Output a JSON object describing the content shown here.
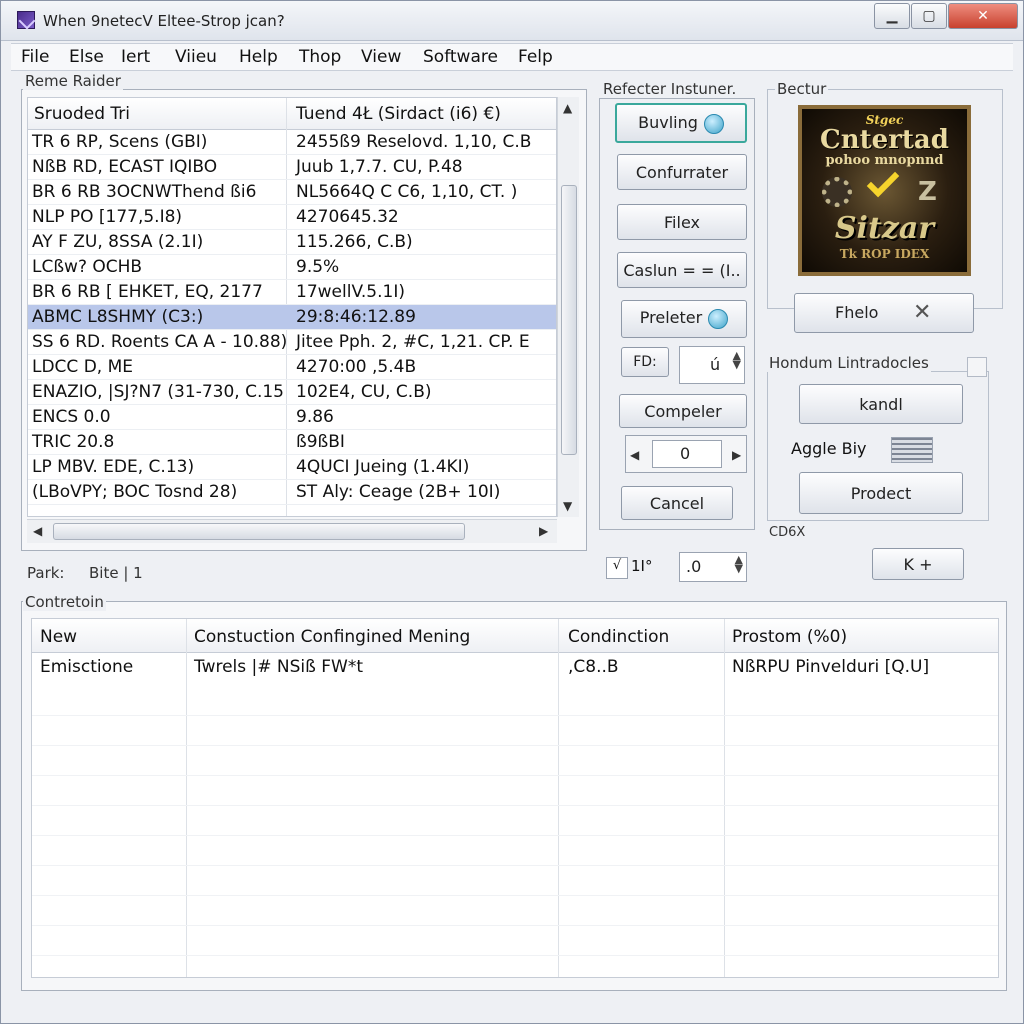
{
  "window": {
    "title": "When 9netecV Eltee-Strop jcan?",
    "controls": [
      "▁",
      "▢",
      "✕"
    ]
  },
  "menu": [
    "File",
    "Else",
    "Iert",
    "Viieu",
    "Help",
    "Thop",
    "View",
    "Software",
    "Felp"
  ],
  "left_panel": {
    "group_label": "Reme Raider",
    "columns": [
      "Sruoded Tri",
      "Tuend 4Ł (Sirdact (i6) €)"
    ],
    "rows": [
      [
        "TR 6 RP, Scens (GBI)",
        "2455ß9 Reselovd. 1,10, C.B"
      ],
      [
        "NßB RD, ECAST IQIBO",
        "Juub 1,7.7. CU, P.48"
      ],
      [
        "BR 6 RB 3OCNWThend ßi6",
        "NL5664Q C C6, 1,10, CT. )"
      ],
      [
        "NLP PO [177,5.I8)",
        "4270645.32"
      ],
      [
        "AY F ZU, 8SSA (2.1I)",
        "115.266, C.B)"
      ],
      [
        "LCßw? OCHB",
        "9.5%"
      ],
      [
        "BR 6 RB [ EHKET, EQ, 2177",
        "17wellV.5.1I)"
      ],
      [
        "ABMC L8SHMY (C3:)",
        "29:8:46:12.89"
      ],
      [
        "SS 6 RD. Roents CA A - 10.88)",
        "Jitee Pph. 2, #C, 1,21. CP. E"
      ],
      [
        "LDCC D, ME",
        "4270:00 ,5.4B"
      ],
      [
        "ENAZIO, |SJ?N7 (31-730, C.15",
        "102E4, CU, C.B)"
      ],
      [
        "ENCS 0.0",
        "9.86"
      ],
      [
        "TRIC 20.8",
        "ß9ßBI"
      ],
      [
        "LP MBV. EDE, C.13)",
        "4QUCI Jueing (1.4KI)"
      ],
      [
        "(LBoVPY; BOC Tosnd 28)",
        "ST Aly: Ceage (2B+ 10I)"
      ]
    ],
    "selected_row": 7,
    "status_label": "Park:",
    "status_value": "Bite | 1"
  },
  "middle_panel": {
    "group_label": "Refecter Instuner.",
    "buttons": {
      "b1": "Buvling",
      "b2": "Confurrater",
      "b3": "Filex",
      "b4": "Caslun = = (I..",
      "b5": "Preleter",
      "b6": "FD:",
      "b7": "Compeler",
      "b8": "Cancel"
    },
    "field1_value": "ú",
    "field2_value": "0",
    "field3_prefix": "√",
    "bottom_spin_label": "1I°",
    "bottom_spin_value": ".0"
  },
  "right_panel": {
    "group_label": "Bectur",
    "logo_text": {
      "line1": "Stgec",
      "line2": "Cntertad",
      "line3": "pohoo mnopnnd",
      "line4": "Sitzar",
      "line5": "Tk  ROP IDEX"
    },
    "logo_glyph": "Z",
    "fhelo_label": "Fhelo",
    "group2_label": "Hondum Lintradocles",
    "buttons": {
      "kandl": "kandl",
      "agglebly_label": "Aggle Biy",
      "prodect": "Prodect",
      "k_plus": "K +"
    },
    "cdex_label": "CD6X"
  },
  "bottom_panel": {
    "group_label": "Contretoin",
    "columns": [
      "New",
      "Constuction Confingined Mening",
      "Condinction",
      "Prostom (%0)"
    ],
    "rows": [
      [
        "Emisctione",
        "Twrels |# NSiß FW*t",
        ",C8..B",
        "NßRPU Pinvelduri [Q.U]"
      ]
    ]
  }
}
